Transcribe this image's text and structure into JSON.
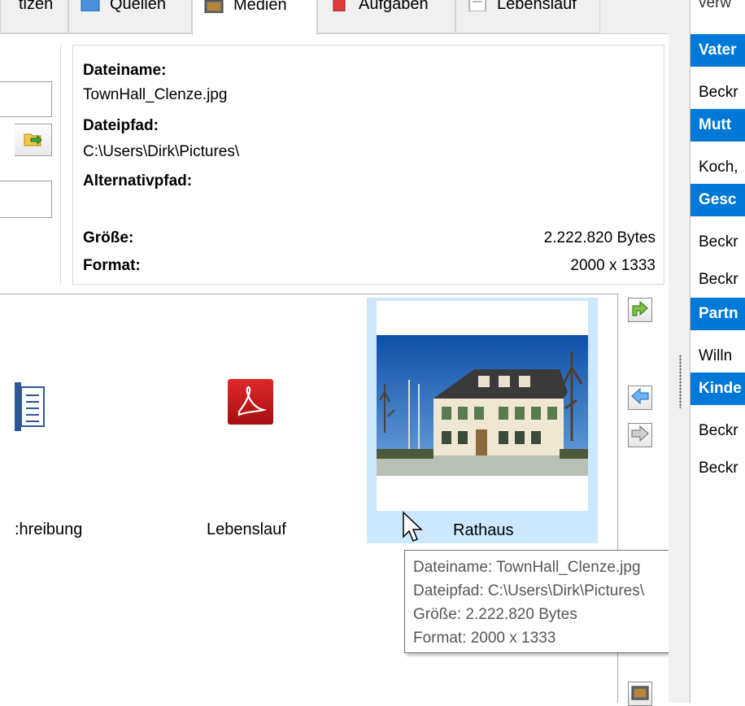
{
  "tabs": [
    {
      "label": "tizen",
      "icon": null
    },
    {
      "label": "Quellen",
      "icon": "sources-icon"
    },
    {
      "label": "Medien",
      "icon": "image-icon"
    },
    {
      "label": "Aufgaben",
      "icon": "task-icon"
    },
    {
      "label": "Lebenslauf",
      "icon": "timeline-icon"
    }
  ],
  "file_info": {
    "filename_label": "Dateiname:",
    "filename_value": "TownHall_Clenze.jpg",
    "path_label": "Dateipfad:",
    "path_value": "C:\\Users\\Dirk\\Pictures\\",
    "altpath_label": "Alternativpfad:",
    "size_label": "Größe:",
    "size_value": "2.222.820 Bytes",
    "format_label": "Format:",
    "format_value": "2000 x 1333"
  },
  "gallery": {
    "items": [
      {
        "label": ":hreibung",
        "icon": "word-document-icon"
      },
      {
        "label": "Lebenslauf",
        "icon": "pdf-icon"
      },
      {
        "label": "Rathaus",
        "icon": "photo-thumbnail"
      }
    ],
    "tooltip": [
      "Dateiname: TownHall_Clenze.jpg",
      "Dateipfad: C:\\Users\\Dirk\\Pictures\\",
      "Größe: 2.222.820 Bytes",
      "Format: 2000 x 1333"
    ]
  },
  "side_buttons": [
    "export-icon",
    "arrow-left-icon",
    "arrow-right-icon",
    "media-icon"
  ],
  "right_panel": {
    "top_text": "verw",
    "sections": [
      {
        "header": "Vater",
        "rows": [
          "Beckr"
        ]
      },
      {
        "header": "Mutt",
        "rows": [
          "Koch,"
        ]
      },
      {
        "header": "Gesc",
        "rows": [
          "Beckr",
          "Beckr"
        ]
      },
      {
        "header": "Partn",
        "rows": [
          "Willn"
        ]
      },
      {
        "header": "Kinde",
        "rows": [
          "Beckr",
          "Beckr"
        ]
      }
    ]
  },
  "colors": {
    "accent": "#0078d7",
    "selection": "#cce8ff",
    "pdf_red": "#c8171a"
  }
}
